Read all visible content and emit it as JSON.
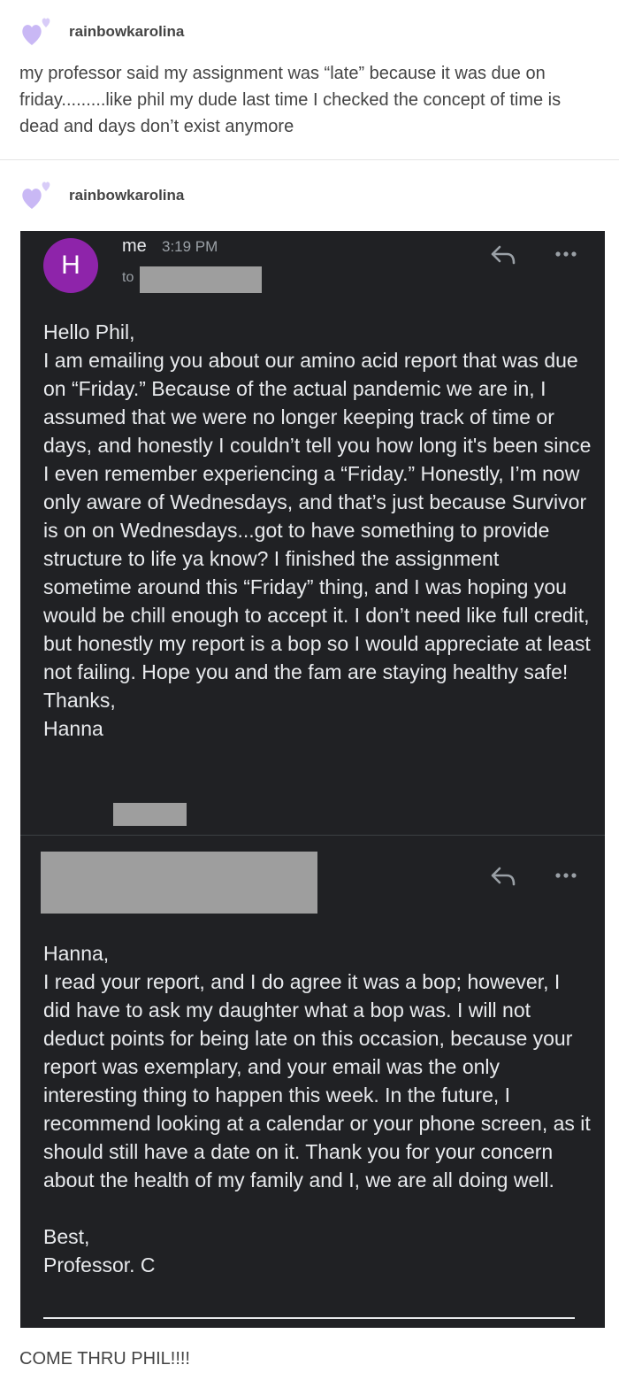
{
  "post1": {
    "username": "rainbowkarolina",
    "text": "my professor said my assignment was “late” because it was due on friday.........like phil my dude last time I checked the concept of time is dead and days don’t exist anymore"
  },
  "post2": {
    "username": "rainbowkarolina"
  },
  "email1": {
    "avatar_letter": "H",
    "sender": "me",
    "time": "3:19 PM",
    "to_label": "to",
    "body": "Hello Phil,\nI am emailing you about our amino acid report that was due on “Friday.” Because of the actual pandemic we are in, I assumed that we were no longer keeping track of time or days, and honestly I couldn’t tell you how long it's been since I even remember experiencing a “Friday.” Honestly, I’m now only aware of Wednesdays, and that’s just because Survivor is on on Wednesdays...got to have something to provide structure to life ya know? I finished the assignment sometime around this “Friday” thing, and I was hoping you would be chill enough to accept it. I don’t need like full credit, but honestly my report is a bop so I would appreciate at least not failing. Hope you and the fam are staying healthy safe!\nThanks,\nHanna"
  },
  "email2": {
    "body": "Hanna,\nI read your report, and I do agree it was a bop; however, I did have to ask my daughter what a bop was. I will not deduct points for being late on this occasion, because your report was exemplary, and your email was the only interesting thing to happen this week. In the future, I recommend looking at a calendar or your phone screen, as it should still have a date on it. Thank you for your concern about the health of my family and I, we are all doing well.\n\nBest,\nProfessor. C"
  },
  "footer": {
    "text": "COME THRU PHIL!!!!"
  },
  "colors": {
    "avatar": "#8e24aa",
    "email_bg": "#202124",
    "heart": "#c9b8f5"
  }
}
